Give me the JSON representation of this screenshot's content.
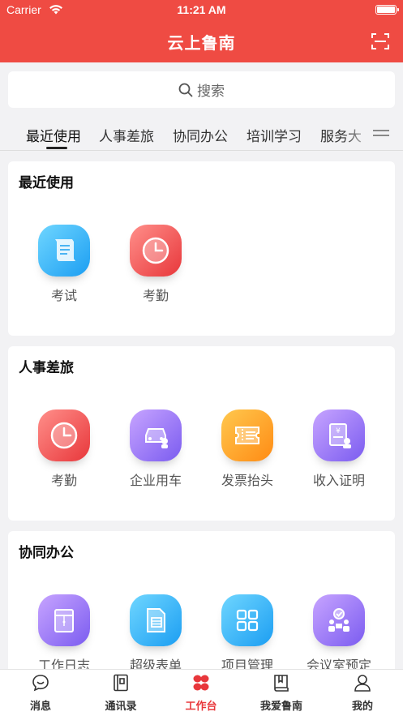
{
  "status_bar": {
    "carrier": "Carrier",
    "time": "11:21 AM"
  },
  "header": {
    "title": "云上鲁南"
  },
  "search": {
    "placeholder": "搜索"
  },
  "tabs": [
    {
      "label": "最近使用"
    },
    {
      "label": "人事差旅"
    },
    {
      "label": "协同办公"
    },
    {
      "label": "培训学习"
    },
    {
      "label": "服务大"
    }
  ],
  "sections": [
    {
      "title": "最近使用",
      "apps": [
        {
          "label": "考试",
          "icon": "exam-icon"
        },
        {
          "label": "考勤",
          "icon": "clock-icon"
        }
      ]
    },
    {
      "title": "人事差旅",
      "apps": [
        {
          "label": "考勤",
          "icon": "clock-icon"
        },
        {
          "label": "企业用车",
          "icon": "car-icon"
        },
        {
          "label": "发票抬头",
          "icon": "invoice-icon"
        },
        {
          "label": "收入证明",
          "icon": "income-proof-icon"
        }
      ]
    },
    {
      "title": "协同办公",
      "apps": [
        {
          "label": "工作日志",
          "icon": "work-log-icon"
        },
        {
          "label": "超级表单",
          "icon": "form-icon"
        },
        {
          "label": "项目管理",
          "icon": "project-grid-icon"
        },
        {
          "label": "会议室预定",
          "icon": "meeting-room-icon"
        }
      ]
    }
  ],
  "tabbar": [
    {
      "label": "消息",
      "icon": "message-icon"
    },
    {
      "label": "通讯录",
      "icon": "contacts-icon"
    },
    {
      "label": "工作台",
      "icon": "workbench-icon"
    },
    {
      "label": "我爱鲁南",
      "icon": "book-icon"
    },
    {
      "label": "我的",
      "icon": "user-icon"
    }
  ],
  "colors": {
    "brand": "#ef4b43",
    "active_tab": "#e8373b"
  }
}
